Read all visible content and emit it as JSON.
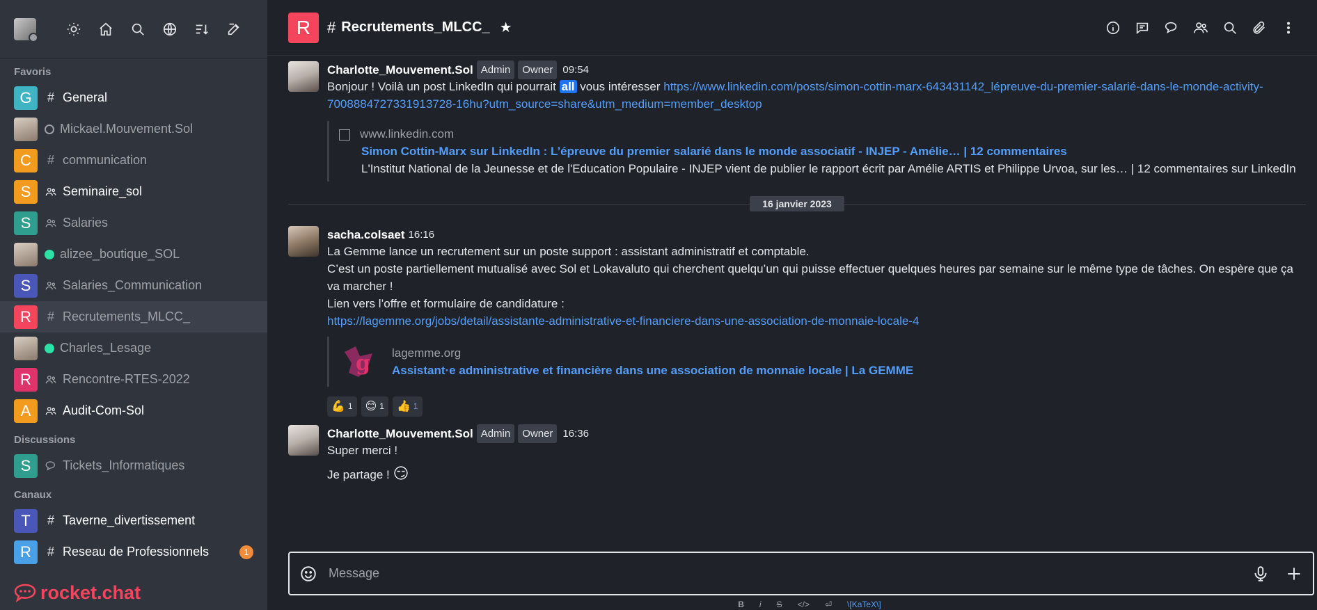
{
  "sidebar": {
    "sections": {
      "favorites": "Favoris",
      "discussions": "Discussions",
      "channels": "Canaux"
    },
    "favorites": [
      {
        "initial": "G",
        "color": "#3fb5c4",
        "type": "#",
        "label": "General",
        "bold": true
      },
      {
        "initial": "",
        "color": "",
        "type": "status-offline",
        "label": "Mickael.Mouvement.Sol",
        "bold": false
      },
      {
        "initial": "C",
        "color": "#f39b1e",
        "type": "#",
        "label": "communication",
        "bold": false
      },
      {
        "initial": "S",
        "color": "#f39b1e",
        "type": "team",
        "label": "Seminaire_sol",
        "bold": true
      },
      {
        "initial": "S",
        "color": "#2f9e8f",
        "type": "team",
        "label": "Salaries",
        "bold": false
      },
      {
        "initial": "",
        "color": "",
        "type": "status-online",
        "label": "alizee_boutique_SOL",
        "bold": false
      },
      {
        "initial": "S",
        "color": "#4a57b8",
        "type": "team",
        "label": "Salaries_Communication",
        "bold": false
      },
      {
        "initial": "R",
        "color": "#f5455c",
        "type": "#",
        "label": "Recrutements_MLCC_",
        "bold": false,
        "active": true
      },
      {
        "initial": "",
        "color": "",
        "type": "status-online",
        "label": "Charles_Lesage",
        "bold": false
      },
      {
        "initial": "R",
        "color": "#e0336b",
        "type": "team",
        "label": "Rencontre-RTES-2022",
        "bold": false
      },
      {
        "initial": "A",
        "color": "#f39b1e",
        "type": "team",
        "label": "Audit-Com-Sol",
        "bold": true
      }
    ],
    "discussions": [
      {
        "initial": "S",
        "color": "#2f9e8f",
        "type": "discussion",
        "label": "Tickets_Informatiques",
        "bold": false
      }
    ],
    "channels": [
      {
        "initial": "T",
        "color": "#4a57b8",
        "type": "#",
        "label": "Taverne_divertissement",
        "bold": true
      },
      {
        "initial": "R",
        "color": "#4aa0e6",
        "type": "#",
        "label": "Reseau de Professionnels",
        "bold": true,
        "badge": "1"
      }
    ],
    "footer_logo": "rocket.chat"
  },
  "room": {
    "initial": "R",
    "name": "Recrutements_MLCC_"
  },
  "messages": {
    "m1": {
      "author": "Charlotte_Mouvement.Sol",
      "roles": [
        "Admin",
        "Owner"
      ],
      "time": "09:54",
      "text_before": "Bonjour ! Voilà un post LinkedIn qui pourrait ",
      "mention": "all",
      "text_after": " vous intéresser ",
      "link": "https://www.linkedin.com/posts/simon-cottin-marx-643431142_lépreuve-du-premier-salarié-dans-le-monde-activity-7008884727331913728-16hu?utm_source=share&utm_medium=member_desktop",
      "preview": {
        "host": "www.linkedin.com",
        "title": "Simon Cottin-Marx sur LinkedIn : L’épreuve du premier salarié dans le monde associatif - INJEP - Amélie… | 12 commentaires",
        "desc": "L'Institut National de la Jeunesse et de l'Education Populaire - INJEP vient de publier le rapport écrit par Amélie ARTIS et Philippe Urvoa, sur les… | 12 commentaires sur LinkedIn"
      }
    },
    "date_divider": "16 janvier 2023",
    "m2": {
      "author": "sacha.colsaet",
      "time": "16:16",
      "line1": "La Gemme lance un recrutement sur un poste support : assistant administratif et comptable.",
      "line2": "C’est un poste partiellement mutualisé avec Sol et Lokavaluto qui cherchent quelqu’un qui puisse effectuer quelques heures par semaine sur le même type de tâches. On espère que ça va marcher !",
      "line3": "Lien vers l’offre et formulaire de candidature :",
      "link": "https://lagemme.org/jobs/detail/assistante-administrative-et-financiere-dans-une-association-de-monnaie-locale-4",
      "preview": {
        "host": "lagemme.org",
        "title": "Assistant·e administrative et financière dans une association de monnaie locale | La GEMME"
      },
      "reactions": [
        {
          "emoji": "💪",
          "count": "1"
        },
        {
          "emoji": "😊",
          "count": "1"
        },
        {
          "emoji": "👍",
          "count": "1"
        }
      ]
    },
    "m3": {
      "author": "Charlotte_Mouvement.Sol",
      "roles": [
        "Admin",
        "Owner"
      ],
      "time": "16:36",
      "line1": "Super merci !",
      "line2": "Je partage !",
      "emoji": "😏"
    }
  },
  "composer": {
    "placeholder": "Message"
  },
  "format_bar": {
    "bold": "B",
    "italic": "i",
    "strike": "S",
    "code": "</>",
    "enter": "⏎",
    "katex": "\\[KaTeX\\]"
  },
  "colors": {
    "sidebar_bg": "#2f343d",
    "main_bg": "#1f2329",
    "accent": "#f5455c",
    "link": "#549df9",
    "online": "#2de0a5"
  }
}
